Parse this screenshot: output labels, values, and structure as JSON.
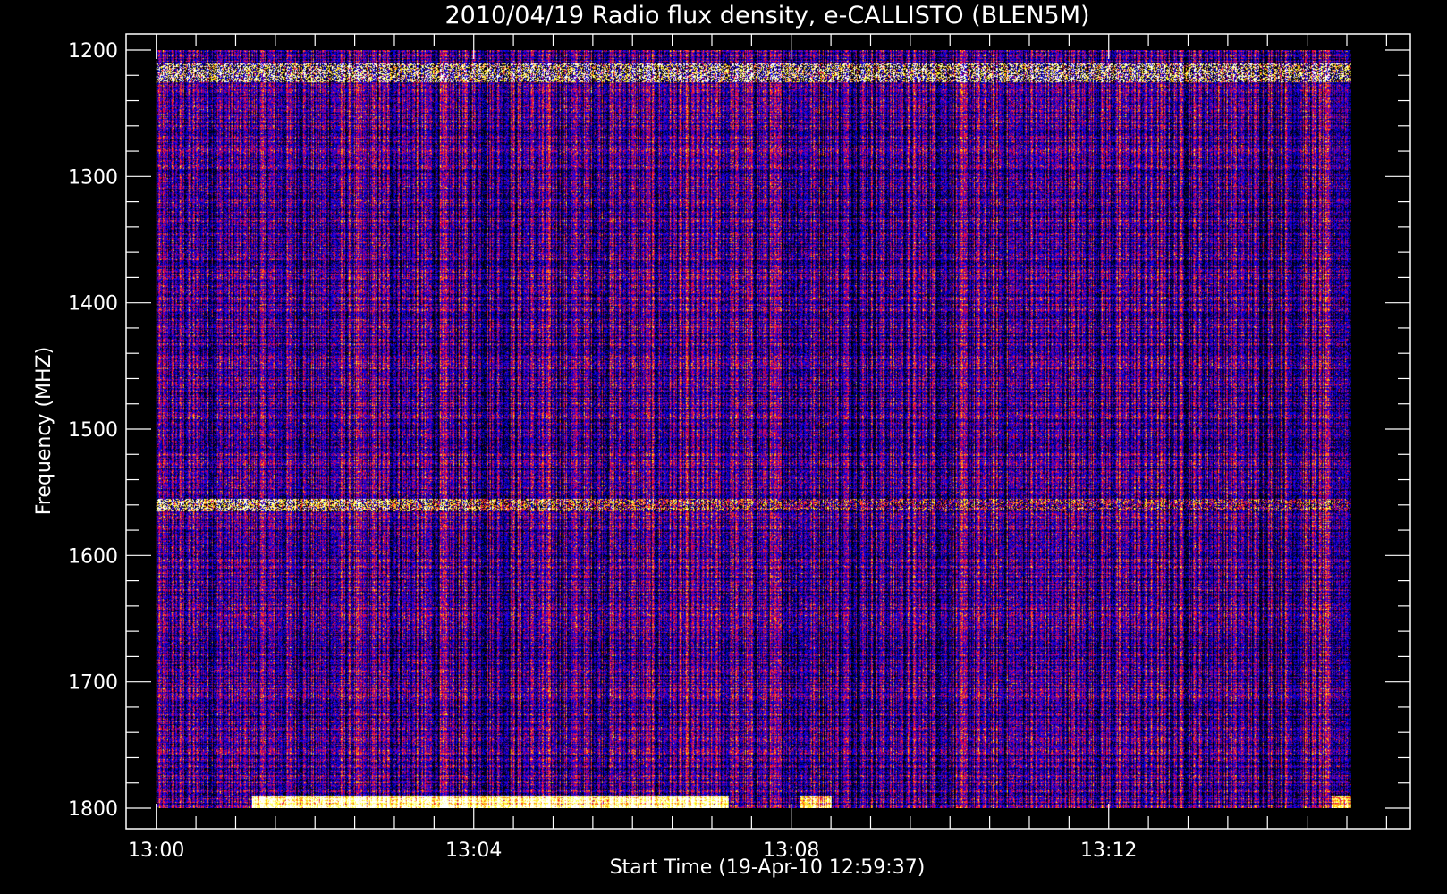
{
  "chart_data": {
    "type": "heatmap",
    "title": "2010/04/19  Radio flux density, e-CALLISTO (BLEN5M)",
    "xlabel": "Start Time (19-Apr-10 12:59:37)",
    "ylabel": "Frequency (MHZ)",
    "x_unit": "minutes after 13:00",
    "x_range_minutes": [
      -0.38,
      15.8
    ],
    "x_ticks": [
      {
        "minute": 0,
        "label": "13:00"
      },
      {
        "minute": 4,
        "label": "13:04"
      },
      {
        "minute": 8,
        "label": "13:08"
      },
      {
        "minute": 12,
        "label": "13:12"
      }
    ],
    "x_data_range_minutes": [
      0,
      15.05
    ],
    "ylim": [
      1800,
      1200
    ],
    "y_data_range": [
      1200,
      1800
    ],
    "y_ticks": [
      1200,
      1300,
      1400,
      1500,
      1600,
      1700,
      1800
    ],
    "y_minor_step": 20,
    "colormap": [
      "#000000",
      "#0000ff",
      "#ff0000",
      "#ffff00",
      "#ffffff"
    ],
    "background_level": "blue",
    "features": [
      {
        "type": "band",
        "frequency_mhz": [
          1210,
          1225
        ],
        "minutes": [
          0,
          15.05
        ],
        "intensity": "bright-intermittent"
      },
      {
        "type": "band",
        "frequency_mhz": [
          1555,
          1565
        ],
        "minutes": [
          0,
          15.05
        ],
        "intensity": "bright-decaying"
      },
      {
        "type": "band",
        "frequency_mhz": [
          1790,
          1800
        ],
        "minutes": [
          1.2,
          7.2
        ],
        "intensity": "very-bright"
      },
      {
        "type": "band",
        "frequency_mhz": [
          1790,
          1800
        ],
        "minutes": [
          8.1,
          8.5
        ],
        "intensity": "bright"
      },
      {
        "type": "band",
        "frequency_mhz": [
          1790,
          1800
        ],
        "minutes": [
          14.8,
          15.05
        ],
        "intensity": "bright"
      }
    ]
  }
}
